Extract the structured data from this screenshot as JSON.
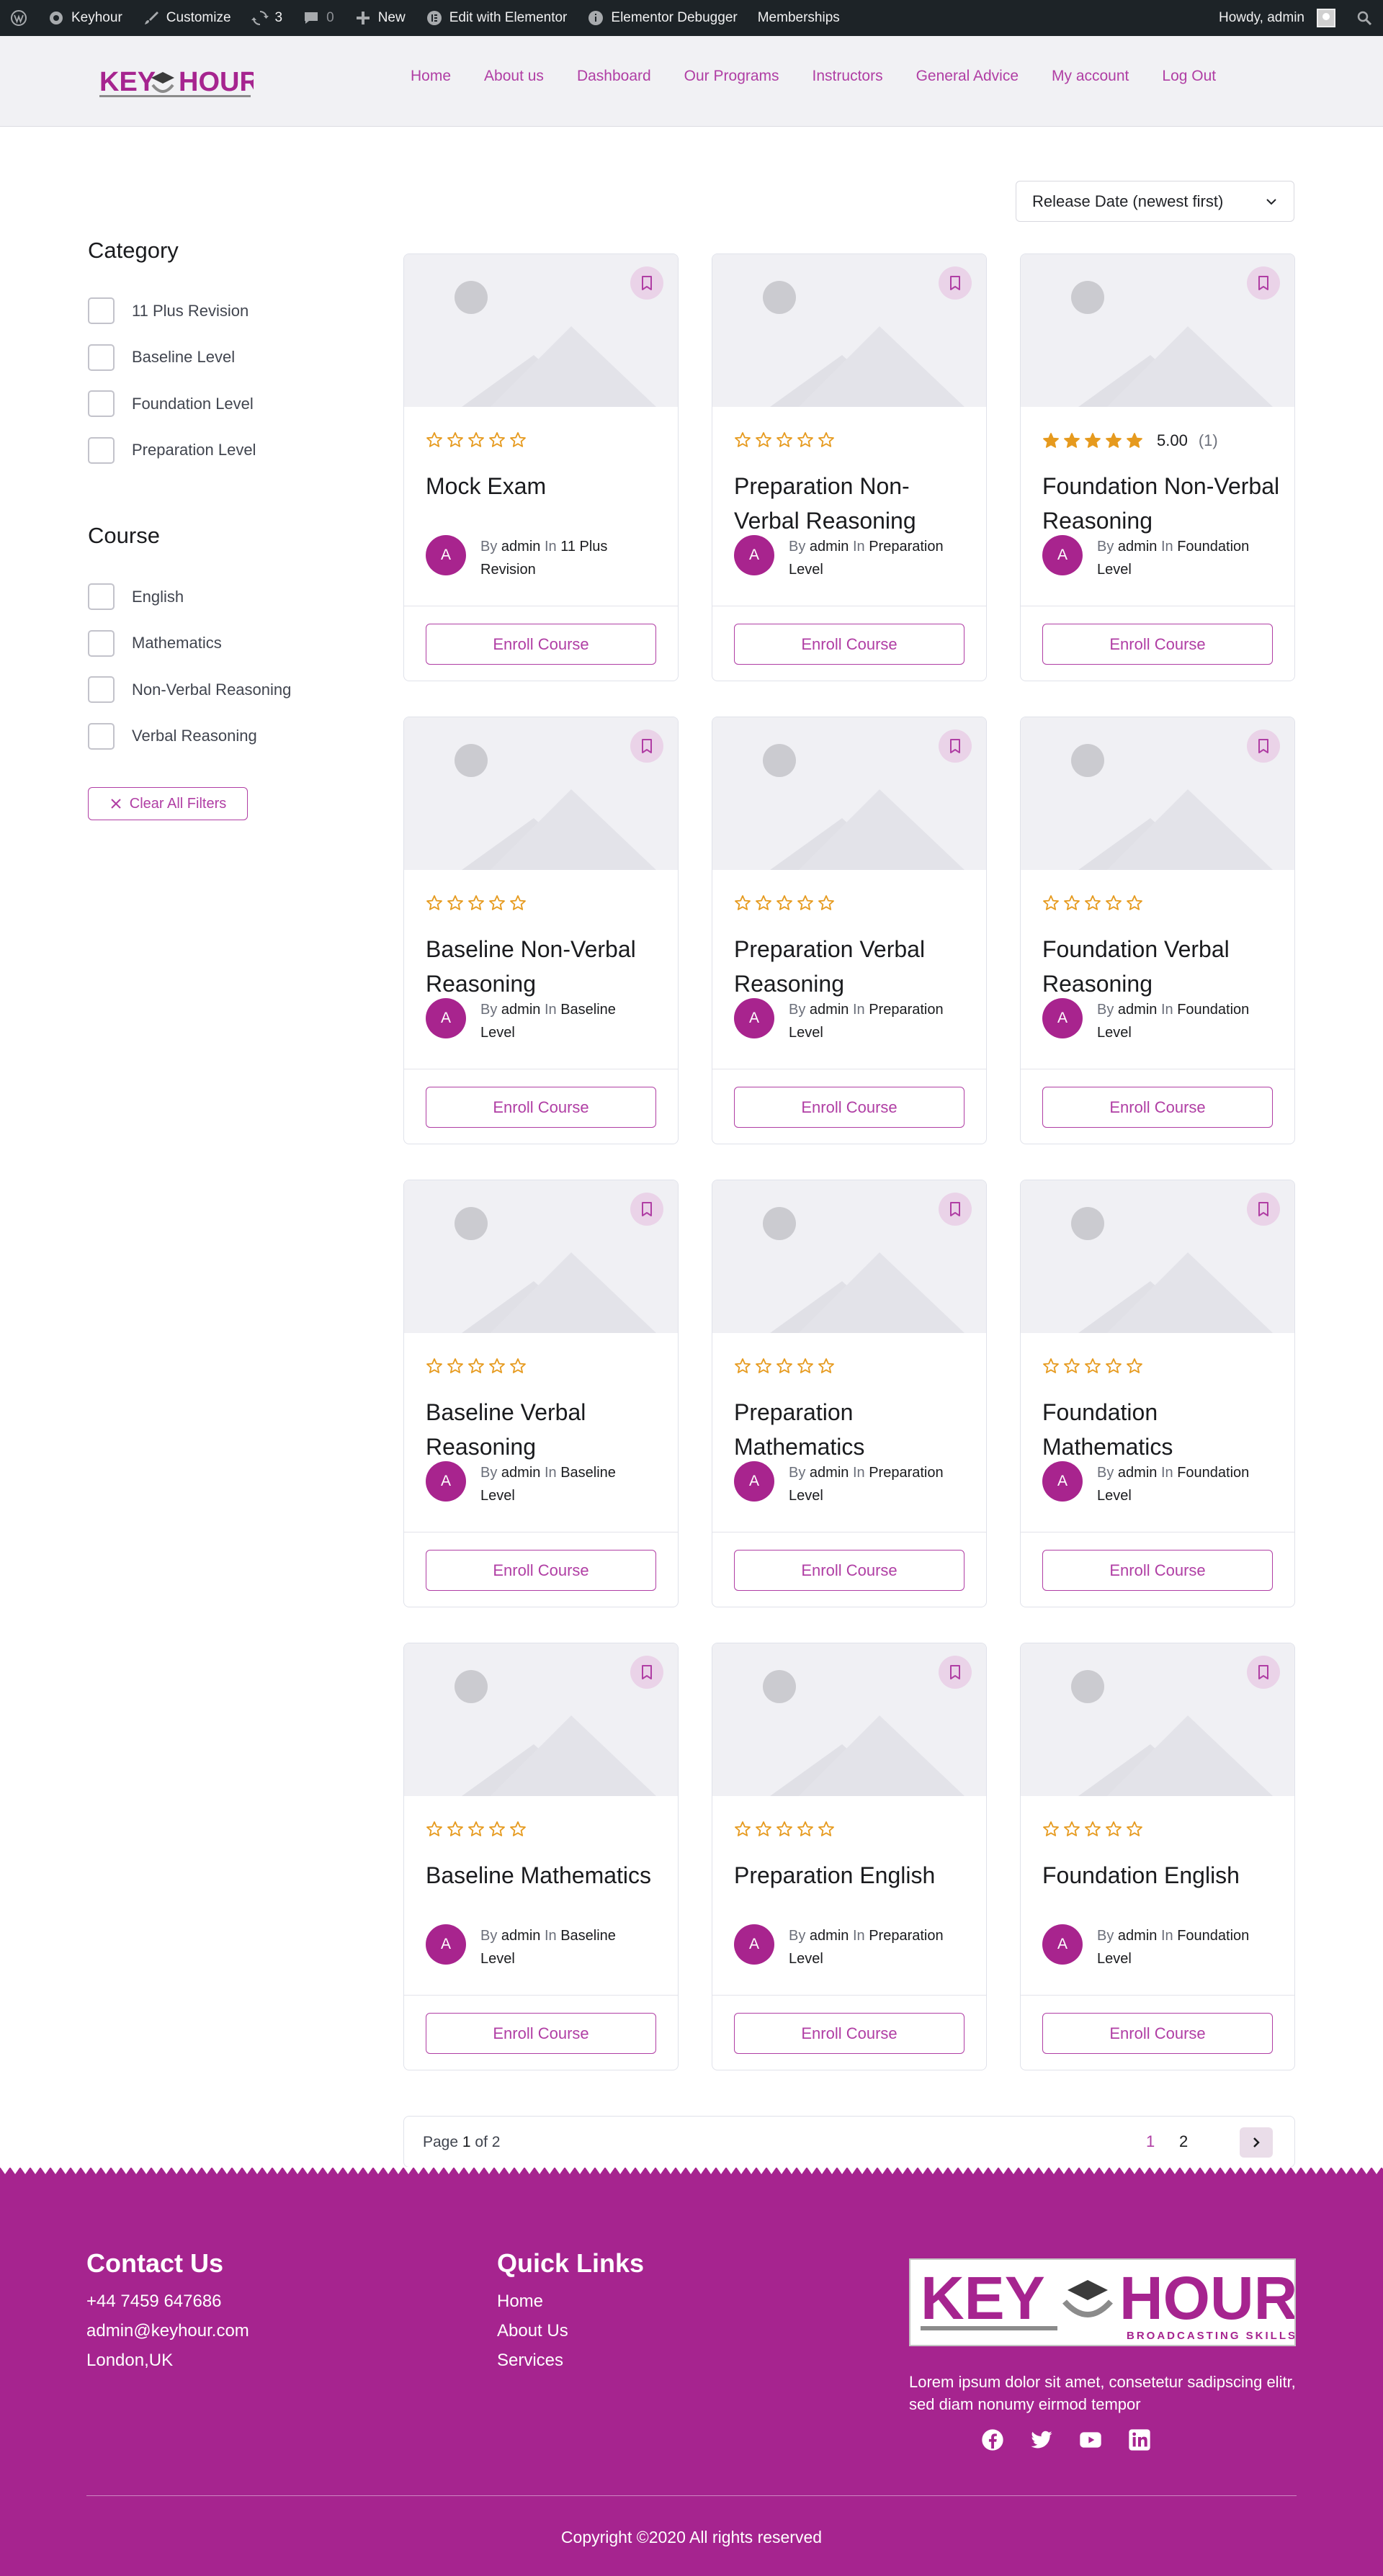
{
  "adminbar": {
    "site_name": "Keyhour",
    "customize": "Customize",
    "updates_count": "3",
    "comments_count": "0",
    "new_label": "New",
    "elementor": "Edit with Elementor",
    "debugger": "Elementor Debugger",
    "memberships": "Memberships",
    "howdy": "Howdy, admin"
  },
  "header": {
    "logo_text_left": "KEY",
    "logo_text_right": "HOUR",
    "nav": [
      "Home",
      "About us",
      "Dashboard",
      "Our Programs",
      "Instructors",
      "General Advice",
      "My account",
      "Log Out"
    ]
  },
  "sort": {
    "selected": "Release Date (newest first)"
  },
  "filters": {
    "category_title": "Category",
    "categories": [
      "11 Plus Revision",
      "Baseline Level",
      "Foundation Level",
      "Preparation Level"
    ],
    "course_title": "Course",
    "courses": [
      "English",
      "Mathematics",
      "Non-Verbal Reasoning",
      "Verbal Reasoning"
    ],
    "clear_label": "Clear All Filters"
  },
  "card_common": {
    "by": "By",
    "in": "In",
    "author": "admin",
    "avatar_letter": "A",
    "enroll": "Enroll Course"
  },
  "cards": [
    {
      "title": "Mock Exam",
      "category": "11 Plus Revision",
      "rating": 0
    },
    {
      "title": "Preparation Non-Verbal Reasoning",
      "category": "Preparation Level",
      "rating": 0
    },
    {
      "title": "Foundation Non-Verbal Reasoning",
      "category": "Foundation Level",
      "rating": 5,
      "rating_value": "5.00",
      "rating_count": "(1)"
    },
    {
      "title": "Baseline Non-Verbal Reasoning",
      "category": "Baseline Level",
      "rating": 0
    },
    {
      "title": "Preparation Verbal Reasoning",
      "category": "Preparation Level",
      "rating": 0
    },
    {
      "title": "Foundation Verbal Reasoning",
      "category": "Foundation Level",
      "rating": 0
    },
    {
      "title": "Baseline Verbal Reasoning",
      "category": "Baseline Level",
      "rating": 0
    },
    {
      "title": "Preparation Mathematics",
      "category": "Preparation Level",
      "rating": 0
    },
    {
      "title": "Foundation Mathematics",
      "category": "Foundation Level",
      "rating": 0
    },
    {
      "title": "Baseline Mathematics",
      "category": "Baseline Level",
      "rating": 0
    },
    {
      "title": "Preparation English",
      "category": "Preparation Level",
      "rating": 0
    },
    {
      "title": "Foundation English",
      "category": "Foundation Level",
      "rating": 0
    }
  ],
  "pagination": {
    "word_page": "Page",
    "current": "1",
    "word_of": "of",
    "total": "2",
    "pages": [
      "1",
      "2"
    ]
  },
  "footer": {
    "contact_title": "Contact Us",
    "contact_lines": [
      "+44 7459 647686",
      "admin@keyhour.com",
      "London,UK"
    ],
    "links_title": "Quick Links",
    "links": [
      "Home",
      "About Us",
      "Services"
    ],
    "logo_left": "KEY",
    "logo_right": "HOUR",
    "logo_tagline": "BROADCASTING SKILLS...",
    "description": "Lorem ipsum dolor sit amet, consetetur sadipscing elitr, sed diam nonumy eirmod tempor",
    "socials": [
      "facebook-icon",
      "twitter-icon",
      "youtube-icon",
      "linkedin-icon"
    ],
    "copyright": "Copyright ©2020 All rights reserved"
  },
  "colors": {
    "accent": "#a6248f",
    "star": "#e69a1e",
    "adminbar": "#1d2327"
  }
}
